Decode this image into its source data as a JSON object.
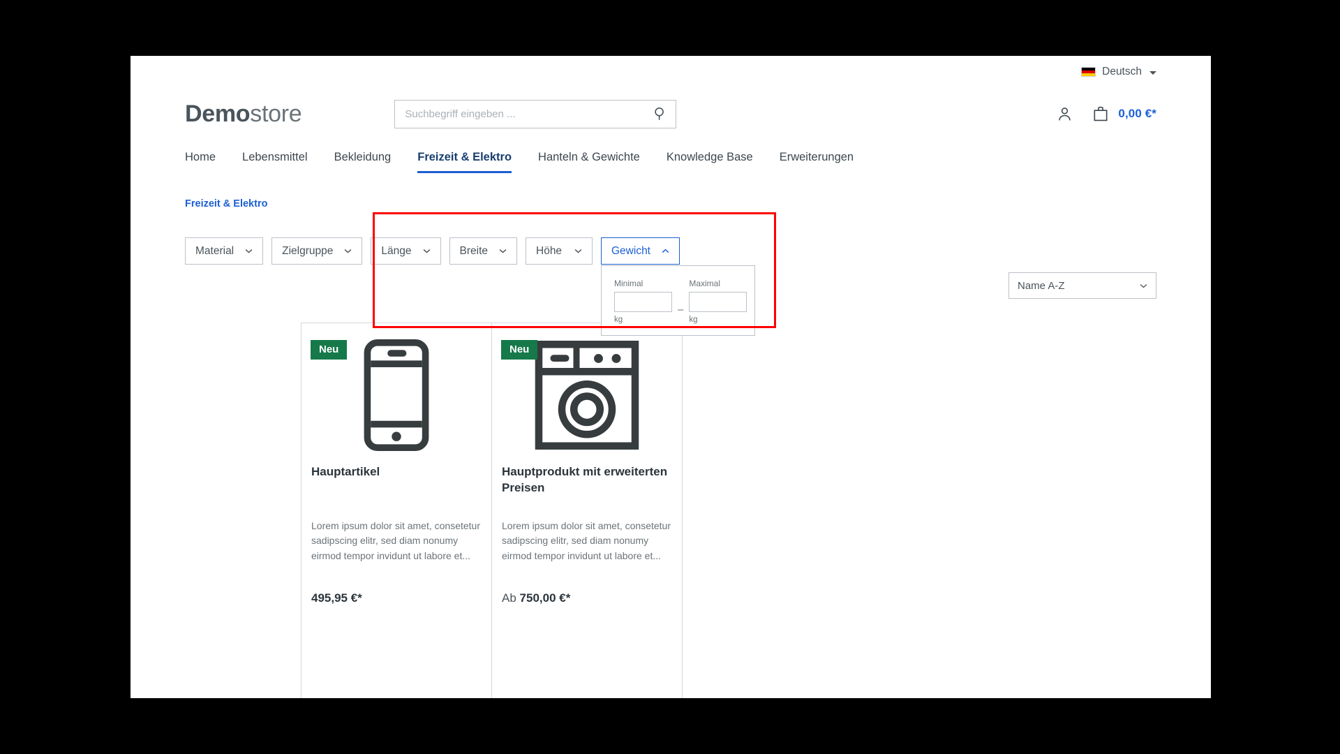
{
  "topbar": {
    "language": "Deutsch",
    "flag_icon": "german-flag-icon"
  },
  "header": {
    "logo_bold": "Demo",
    "logo_light": "store",
    "search_placeholder": "Suchbegriff eingeben ...",
    "search_value": "",
    "search_icon": "search-icon",
    "account_icon": "user-icon",
    "cart_icon": "shopping-bag-icon",
    "cart_total": "0,00 €*",
    "accent_color": "#1c5fd4"
  },
  "nav": {
    "items": [
      {
        "label": "Home",
        "active": false
      },
      {
        "label": "Lebensmittel",
        "active": false
      },
      {
        "label": "Bekleidung",
        "active": false
      },
      {
        "label": "Freizeit & Elektro",
        "active": true
      },
      {
        "label": "Hanteln & Gewichte",
        "active": false
      },
      {
        "label": "Knowledge Base",
        "active": false
      },
      {
        "label": "Erweiterungen",
        "active": false
      }
    ]
  },
  "breadcrumb": {
    "label": "Freizeit & Elektro"
  },
  "filters": {
    "buttons": [
      {
        "label": "Material",
        "open": false,
        "chevron": "chevron-down-icon"
      },
      {
        "label": "Zielgruppe",
        "open": false,
        "chevron": "chevron-down-icon"
      },
      {
        "label": "Länge",
        "open": false,
        "chevron": "chevron-down-icon"
      },
      {
        "label": "Breite",
        "open": false,
        "chevron": "chevron-down-icon"
      },
      {
        "label": "Höhe",
        "open": false,
        "chevron": "chevron-down-icon"
      },
      {
        "label": "Gewicht",
        "open": true,
        "chevron": "chevron-up-icon"
      }
    ],
    "weight_panel": {
      "min_label": "Minimal",
      "min_value": "",
      "min_unit": "kg",
      "separator": "–",
      "max_label": "Maximal",
      "max_value": "",
      "max_unit": "kg"
    }
  },
  "annotation": {
    "highlight_color": "#ff0000"
  },
  "sorting": {
    "selected": "Name A-Z",
    "chevron": "chevron-down-icon"
  },
  "products": [
    {
      "badge": "Neu",
      "badge_color": "#16794a",
      "image_icon": "smartphone-icon",
      "title": "Hauptartikel",
      "description": "Lorem ipsum dolor sit amet, consetetur sadipscing elitr, sed diam nonumy eirmod tempor invidunt ut labore et...",
      "price_prefix": "",
      "price": "495,95 €*"
    },
    {
      "badge": "Neu",
      "badge_color": "#16794a",
      "image_icon": "washing-machine-icon",
      "title": "Hauptprodukt mit erweiterten Preisen",
      "description": "Lorem ipsum dolor sit amet, consetetur sadipscing elitr, sed diam nonumy eirmod tempor invidunt ut labore et...",
      "price_prefix": "Ab ",
      "price": "750,00 €*"
    }
  ]
}
